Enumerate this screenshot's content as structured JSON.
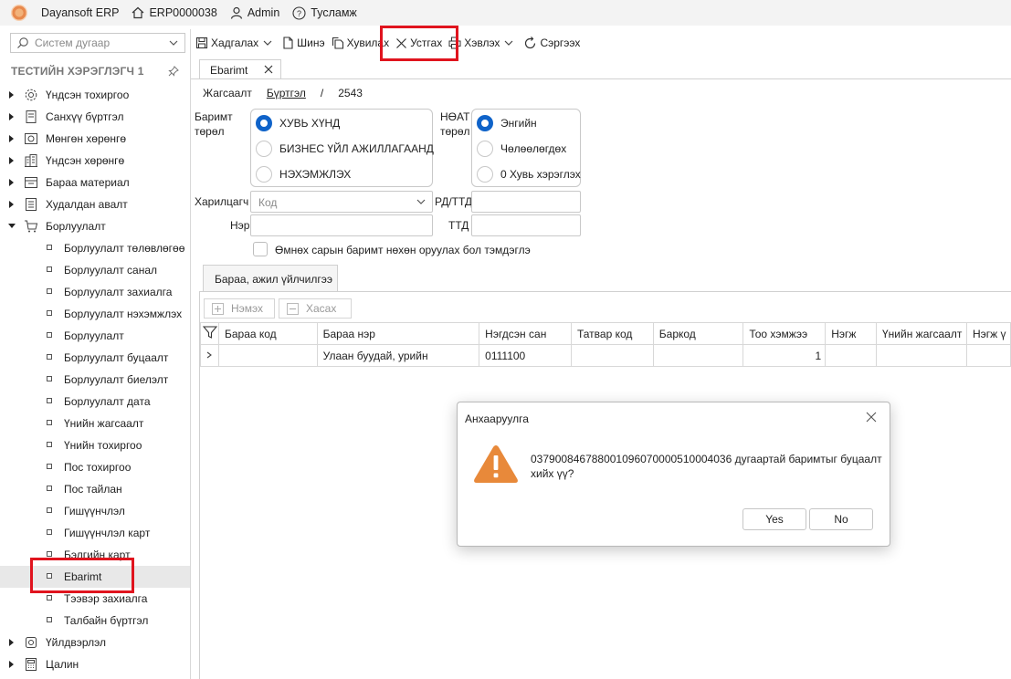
{
  "titlebar": {
    "app_name": "Dayansoft ERP",
    "company": "ERP0000038",
    "user": "Admin",
    "help": "Тусламж"
  },
  "left": {
    "search_placeholder": "Систем дугаар",
    "panel_title": "ТЕСТИЙН ХЭРЭГЛЭГЧ 1",
    "tree_top": [
      {
        "label": "Үндсэн тохиргоо",
        "icon": "gear-icon"
      },
      {
        "label": "Санхүү бүртгэл",
        "icon": "ledger-icon"
      },
      {
        "label": "Мөнгөн хөрөнгө",
        "icon": "cash-icon"
      },
      {
        "label": "Үндсэн хөрөнгө",
        "icon": "building-icon"
      },
      {
        "label": "Бараа материал",
        "icon": "inventory-icon"
      },
      {
        "label": "Худалдан авалт",
        "icon": "purchase-icon"
      },
      {
        "label": "Борлуулалт",
        "icon": "cart-icon"
      }
    ],
    "sales_children": [
      "Борлуулалт төлөвлөгөө",
      "Борлуулалт санал",
      "Борлуулалт захиалга",
      "Борлуулалт нэхэмжлэх",
      "Борлуулалт",
      "Борлуулалт буцаалт",
      "Борлуулалт биелэлт",
      "Борлуулалт дата",
      "Үнийн жагсаалт",
      "Үнийн тохиргоо",
      "Пос тохиргоо",
      "Пос тайлан",
      "Гишүүнчлэл",
      "Гишүүнчлэл карт",
      "Бэлгийн карт",
      "Ebarimt",
      "Тээвэр захиалга",
      "Талбайн бүртгэл"
    ],
    "selected_child": "Ebarimt",
    "tree_bottom": [
      {
        "label": "Үйлдвэрлэл",
        "icon": "factory-icon"
      },
      {
        "label": "Цалин",
        "icon": "calculator-icon"
      }
    ]
  },
  "toolbar": {
    "save": "Хадгалах",
    "new": "Шинэ",
    "copy": "Хувилах",
    "cancel": "Устгах",
    "print": "Хэвлэх",
    "refresh": "Сэргээх"
  },
  "doc_tab": {
    "label": "Ebarimt"
  },
  "crumb": {
    "list": "Жагсаалт",
    "register": "Бүртгэл",
    "sep": "/",
    "number": "2543"
  },
  "form": {
    "receipt_type_label": "Баримт төрөл",
    "receipt_types": [
      "ХУВЬ ХҮНД",
      "БИЗНЕС ҮЙЛ АЖИЛЛАГААНД",
      "НЭХЭМЖЛЭХ"
    ],
    "vat_type_label": "НӨАТ төрөл",
    "vat_types": [
      "Энгийн",
      "Чөлөөлөгдөх",
      "0 Хувь хэрэглэх"
    ],
    "partner_label": "Харилцагч",
    "partner_placeholder": "Код",
    "regno_label": "РД/ТТД",
    "name_label": "Нэр",
    "ttd_label": "ТТД",
    "prev_year_check": "Өмнөх сарын баримт нөхөн оруулах бол тэмдэглэ"
  },
  "subtab": {
    "label": "Бараа, ажил үйлчилгээ"
  },
  "grid": {
    "add": "Нэмэх",
    "remove": "Хасах",
    "columns": [
      "Бараа код",
      "Бараа нэр",
      "Нэгдсэн сан",
      "Татвар код",
      "Баркод",
      "Тоо хэмжээ",
      "Нэгж",
      "Үнийн жагсаалт",
      "Нэгж ү"
    ],
    "rows": [
      {
        "code": "",
        "name": "Улаан буудай, урийн",
        "fund": "0111100",
        "tax": "",
        "barcode": "",
        "qty": "1",
        "unit": "",
        "pricelist": "",
        "unitprice": ""
      }
    ]
  },
  "dialog": {
    "title": "Анхааруулга",
    "message": "037900846788001096070000510004036 дугаартай баримтыг буцаалт хийх үү?",
    "yes": "Yes",
    "no": "No"
  },
  "colors": {
    "accent": "#0f63c9",
    "warning": "#e8893a",
    "highlight": "#e0141e"
  }
}
